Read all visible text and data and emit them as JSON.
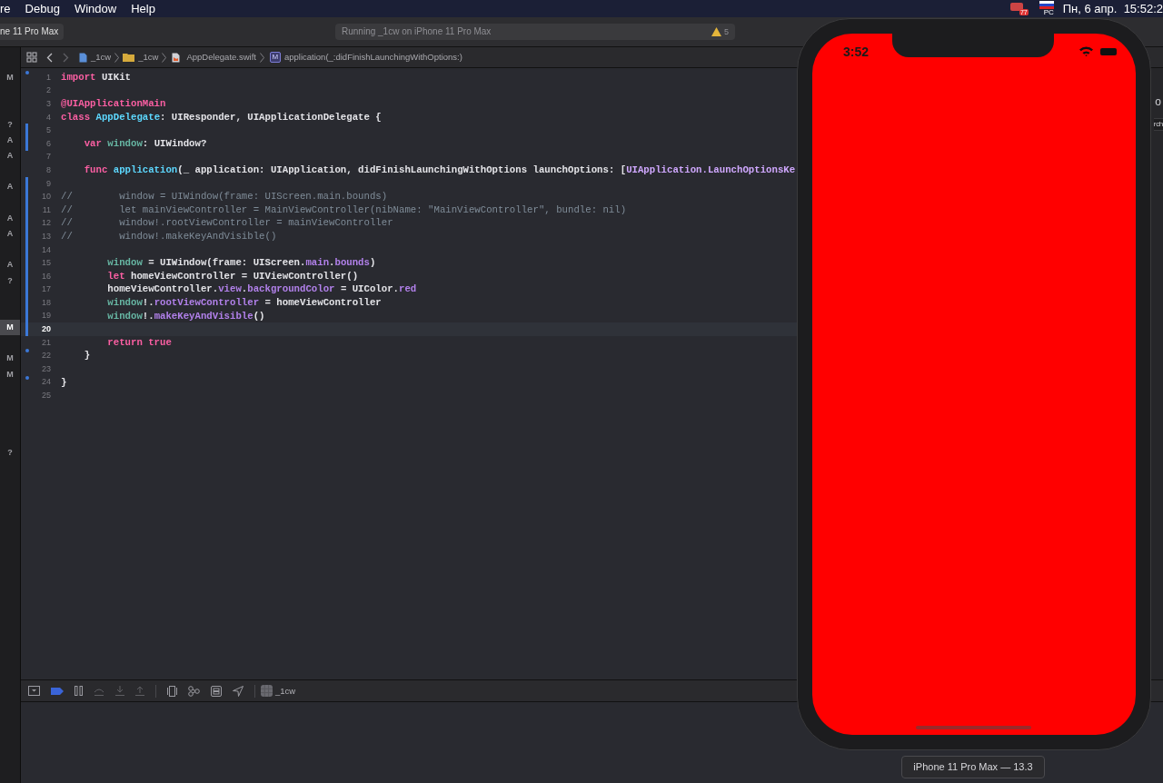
{
  "menu_bar": {
    "items": [
      "re",
      "Debug",
      "Window",
      "Help"
    ],
    "status_badge": "77",
    "flag_label": "РС",
    "clock": "Пн, 6 апр.  15:52:2"
  },
  "toolbar": {
    "scheme": "ne 11 Pro Max",
    "activity": "Running _1cw on iPhone 11 Pro Max",
    "warnings": "5"
  },
  "jump_bar": {
    "project": "_1cw",
    "group": "_1cw",
    "file": "AppDelegate.swift",
    "method_badge": "M",
    "method": "application(_:didFinishLaunchingWithOptions:)"
  },
  "navigator_badges": [
    {
      "badge": "M",
      "selected": false
    },
    {
      "badge": "?",
      "selected": false
    },
    {
      "badge": "A",
      "selected": false
    },
    {
      "badge": "A",
      "selected": false
    },
    {
      "badge": "A",
      "selected": false
    },
    {
      "badge": "A",
      "selected": false
    },
    {
      "badge": "A",
      "selected": false
    },
    {
      "badge": "A",
      "selected": false
    },
    {
      "badge": "?",
      "selected": false
    },
    {
      "badge": "M",
      "selected": true
    },
    {
      "badge": "M",
      "selected": false
    },
    {
      "badge": "M",
      "selected": false
    },
    {
      "badge": "?",
      "selected": false
    }
  ],
  "code_lines": [
    {
      "number": "1",
      "selected": false,
      "changed": false,
      "dot": true,
      "tokens": [
        {
          "kind": "kw",
          "text": "import"
        },
        {
          "kind": "plain",
          "text": " UIKit"
        }
      ]
    },
    {
      "number": "2",
      "selected": false,
      "changed": false,
      "dot": false
    },
    {
      "number": "3",
      "selected": false,
      "changed": false,
      "dot": false,
      "tokens": [
        {
          "kind": "kw",
          "text": "@UIApplicationMain"
        }
      ]
    },
    {
      "number": "4",
      "selected": false,
      "changed": false,
      "dot": false,
      "tokens": [
        {
          "kind": "kw",
          "text": "class"
        },
        {
          "kind": "decl",
          "text": " AppDelegate"
        },
        {
          "kind": "plain",
          "text": ": UIResponder, UIApplicationDelegate {"
        }
      ]
    },
    {
      "number": "5",
      "selected": false,
      "changed": true,
      "dot": false
    },
    {
      "number": "6",
      "selected": false,
      "changed": true,
      "dot": false,
      "tokens": [
        {
          "kind": "kw",
          "text": "    var"
        },
        {
          "kind": "proj",
          "text": " window"
        },
        {
          "kind": "plain",
          "text": ": UIWindow?"
        }
      ]
    },
    {
      "number": "7",
      "selected": false,
      "changed": false,
      "dot": false
    },
    {
      "number": "8",
      "selected": false,
      "changed": false,
      "dot": false,
      "tokens": [
        {
          "kind": "kw",
          "text": "    func"
        },
        {
          "kind": "decl",
          "text": " application"
        },
        {
          "kind": "plain",
          "text": "(_ application: UIApplication, didFinishLaunchingWithOptions launchOptions: ["
        },
        {
          "kind": "ext",
          "text": "UIApplication.LaunchOptionsKe"
        }
      ]
    },
    {
      "number": "9",
      "selected": false,
      "changed": true,
      "dot": false
    },
    {
      "number": "10",
      "selected": false,
      "changed": true,
      "dot": false,
      "tokens": [
        {
          "kind": "comment",
          "text": "//        window = UIWindow(frame: UIScreen.main.bounds)"
        }
      ]
    },
    {
      "number": "11",
      "selected": false,
      "changed": true,
      "dot": false,
      "tokens": [
        {
          "kind": "comment",
          "text": "//        let mainViewController = MainViewController(nibName: \"MainViewController\", bundle: nil)"
        }
      ]
    },
    {
      "number": "12",
      "selected": false,
      "changed": true,
      "dot": false,
      "tokens": [
        {
          "kind": "comment",
          "text": "//        window!.rootViewController = mainViewController"
        }
      ]
    },
    {
      "number": "13",
      "selected": false,
      "changed": true,
      "dot": false,
      "tokens": [
        {
          "kind": "comment",
          "text": "//        window!.makeKeyAndVisible()"
        }
      ]
    },
    {
      "number": "14",
      "selected": false,
      "changed": true,
      "dot": false
    },
    {
      "number": "15",
      "selected": false,
      "changed": true,
      "dot": false,
      "tokens": [
        {
          "kind": "proj",
          "text": "        window"
        },
        {
          "kind": "plain",
          "text": " = UIWindow(frame: UIScreen."
        },
        {
          "kind": "sys",
          "text": "main"
        },
        {
          "kind": "plain",
          "text": "."
        },
        {
          "kind": "sys",
          "text": "bounds"
        },
        {
          "kind": "plain",
          "text": ")"
        }
      ]
    },
    {
      "number": "16",
      "selected": false,
      "changed": true,
      "dot": false,
      "tokens": [
        {
          "kind": "kw",
          "text": "        let"
        },
        {
          "kind": "plain",
          "text": " homeViewController = UIViewController()"
        }
      ]
    },
    {
      "number": "17",
      "selected": false,
      "changed": true,
      "dot": false,
      "tokens": [
        {
          "kind": "plain",
          "text": "        homeViewController."
        },
        {
          "kind": "sys",
          "text": "view"
        },
        {
          "kind": "plain",
          "text": "."
        },
        {
          "kind": "sys",
          "text": "backgroundColor"
        },
        {
          "kind": "plain",
          "text": " = UIColor."
        },
        {
          "kind": "sys",
          "text": "red"
        }
      ]
    },
    {
      "number": "18",
      "selected": false,
      "changed": true,
      "dot": false,
      "tokens": [
        {
          "kind": "proj",
          "text": "        window"
        },
        {
          "kind": "plain",
          "text": "!."
        },
        {
          "kind": "sys",
          "text": "rootViewController"
        },
        {
          "kind": "plain",
          "text": " = homeViewController"
        }
      ]
    },
    {
      "number": "19",
      "selected": false,
      "changed": true,
      "dot": false,
      "tokens": [
        {
          "kind": "proj",
          "text": "        window"
        },
        {
          "kind": "plain",
          "text": "!."
        },
        {
          "kind": "sys",
          "text": "makeKeyAndVisible"
        },
        {
          "kind": "plain",
          "text": "()"
        }
      ]
    },
    {
      "number": "20",
      "selected": true,
      "changed": true,
      "dot": false
    },
    {
      "number": "21",
      "selected": false,
      "changed": false,
      "dot": false,
      "tokens": [
        {
          "kind": "kw",
          "text": "        return true"
        }
      ]
    },
    {
      "number": "22",
      "selected": false,
      "changed": false,
      "dot": true,
      "tokens": [
        {
          "kind": "plain",
          "text": "    }"
        }
      ]
    },
    {
      "number": "23",
      "selected": false,
      "changed": false,
      "dot": false
    },
    {
      "number": "24",
      "selected": false,
      "changed": false,
      "dot": true,
      "tokens": [
        {
          "kind": "plain",
          "text": "}"
        }
      ]
    },
    {
      "number": "25",
      "selected": false,
      "changed": false,
      "dot": false
    }
  ],
  "inspector_fragments": {
    "title": "o",
    "field": "rch"
  },
  "debug_bar": {
    "target": "_1cw"
  },
  "simulator": {
    "time": "3:52",
    "device_label": "iPhone 11 Pro Max — 13.3"
  }
}
